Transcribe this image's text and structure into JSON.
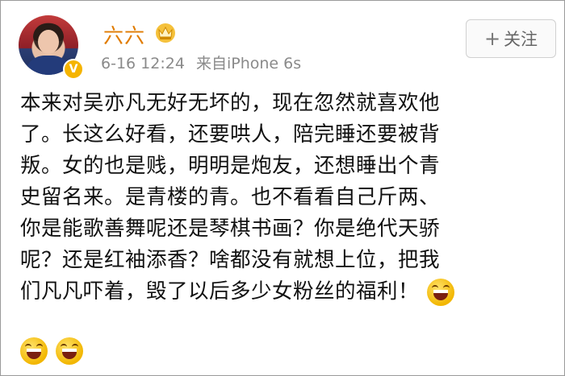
{
  "post": {
    "author": {
      "name": "六六",
      "vip_icon": "vip-crown-icon",
      "verified_icon": "verified-v-icon",
      "verified_mark": "V"
    },
    "meta": {
      "time": "6-16 12:24",
      "source": "来自iPhone 6s"
    },
    "follow_button": {
      "plus": "+",
      "label": "关注"
    },
    "body_lines": [
      "本来对吴亦凡无好无坏的，现在忽然就喜欢他",
      "了。长这么好看，还要哄人，陪完睡还要被背",
      "叛。女的也是贱，明明是炮友，还想睡出个青",
      "史留名来。是青楼的青。也不看看自己斤两、",
      "你是能歌善舞呢还是琴棋书画？你是绝代天骄",
      "呢？还是红袖添香？啥都没有就想上位，把我",
      "们凡凡吓着，毁了以后多少女粉丝的福利！"
    ],
    "emoji_icon": "laughing-emoji-icon"
  },
  "colors": {
    "username": "#e07b00",
    "meta": "#8a8a8a",
    "text": "#111111",
    "badge": "#f5b400"
  }
}
